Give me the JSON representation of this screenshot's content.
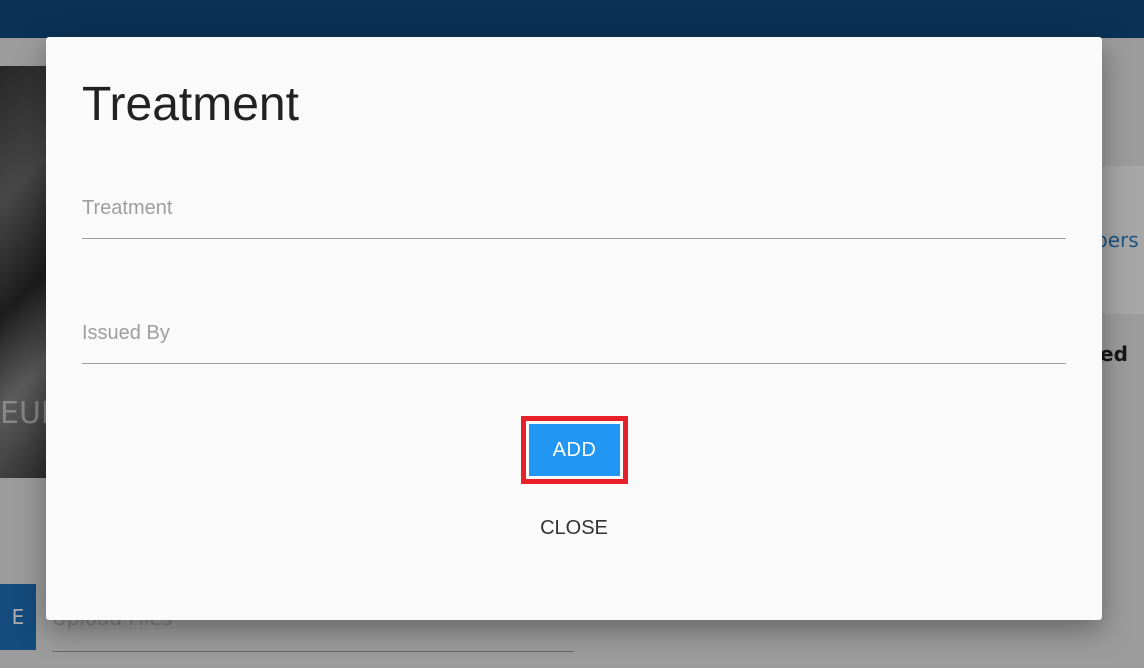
{
  "background": {
    "hero_text": "EUI",
    "right_link_text": "pers",
    "right_bold_text": "ed",
    "side_button_label": "E",
    "upload_label": "Upload Files"
  },
  "dialog": {
    "title": "Treatment",
    "fields": {
      "treatment": {
        "value": "",
        "placeholder": "Treatment"
      },
      "issued_by": {
        "value": "",
        "placeholder": "Issued By"
      }
    },
    "add_label": "ADD",
    "close_label": "CLOSE"
  },
  "colors": {
    "topbar": "#0f4a7e",
    "primary": "#2196f3",
    "highlight": "#e8202a"
  }
}
